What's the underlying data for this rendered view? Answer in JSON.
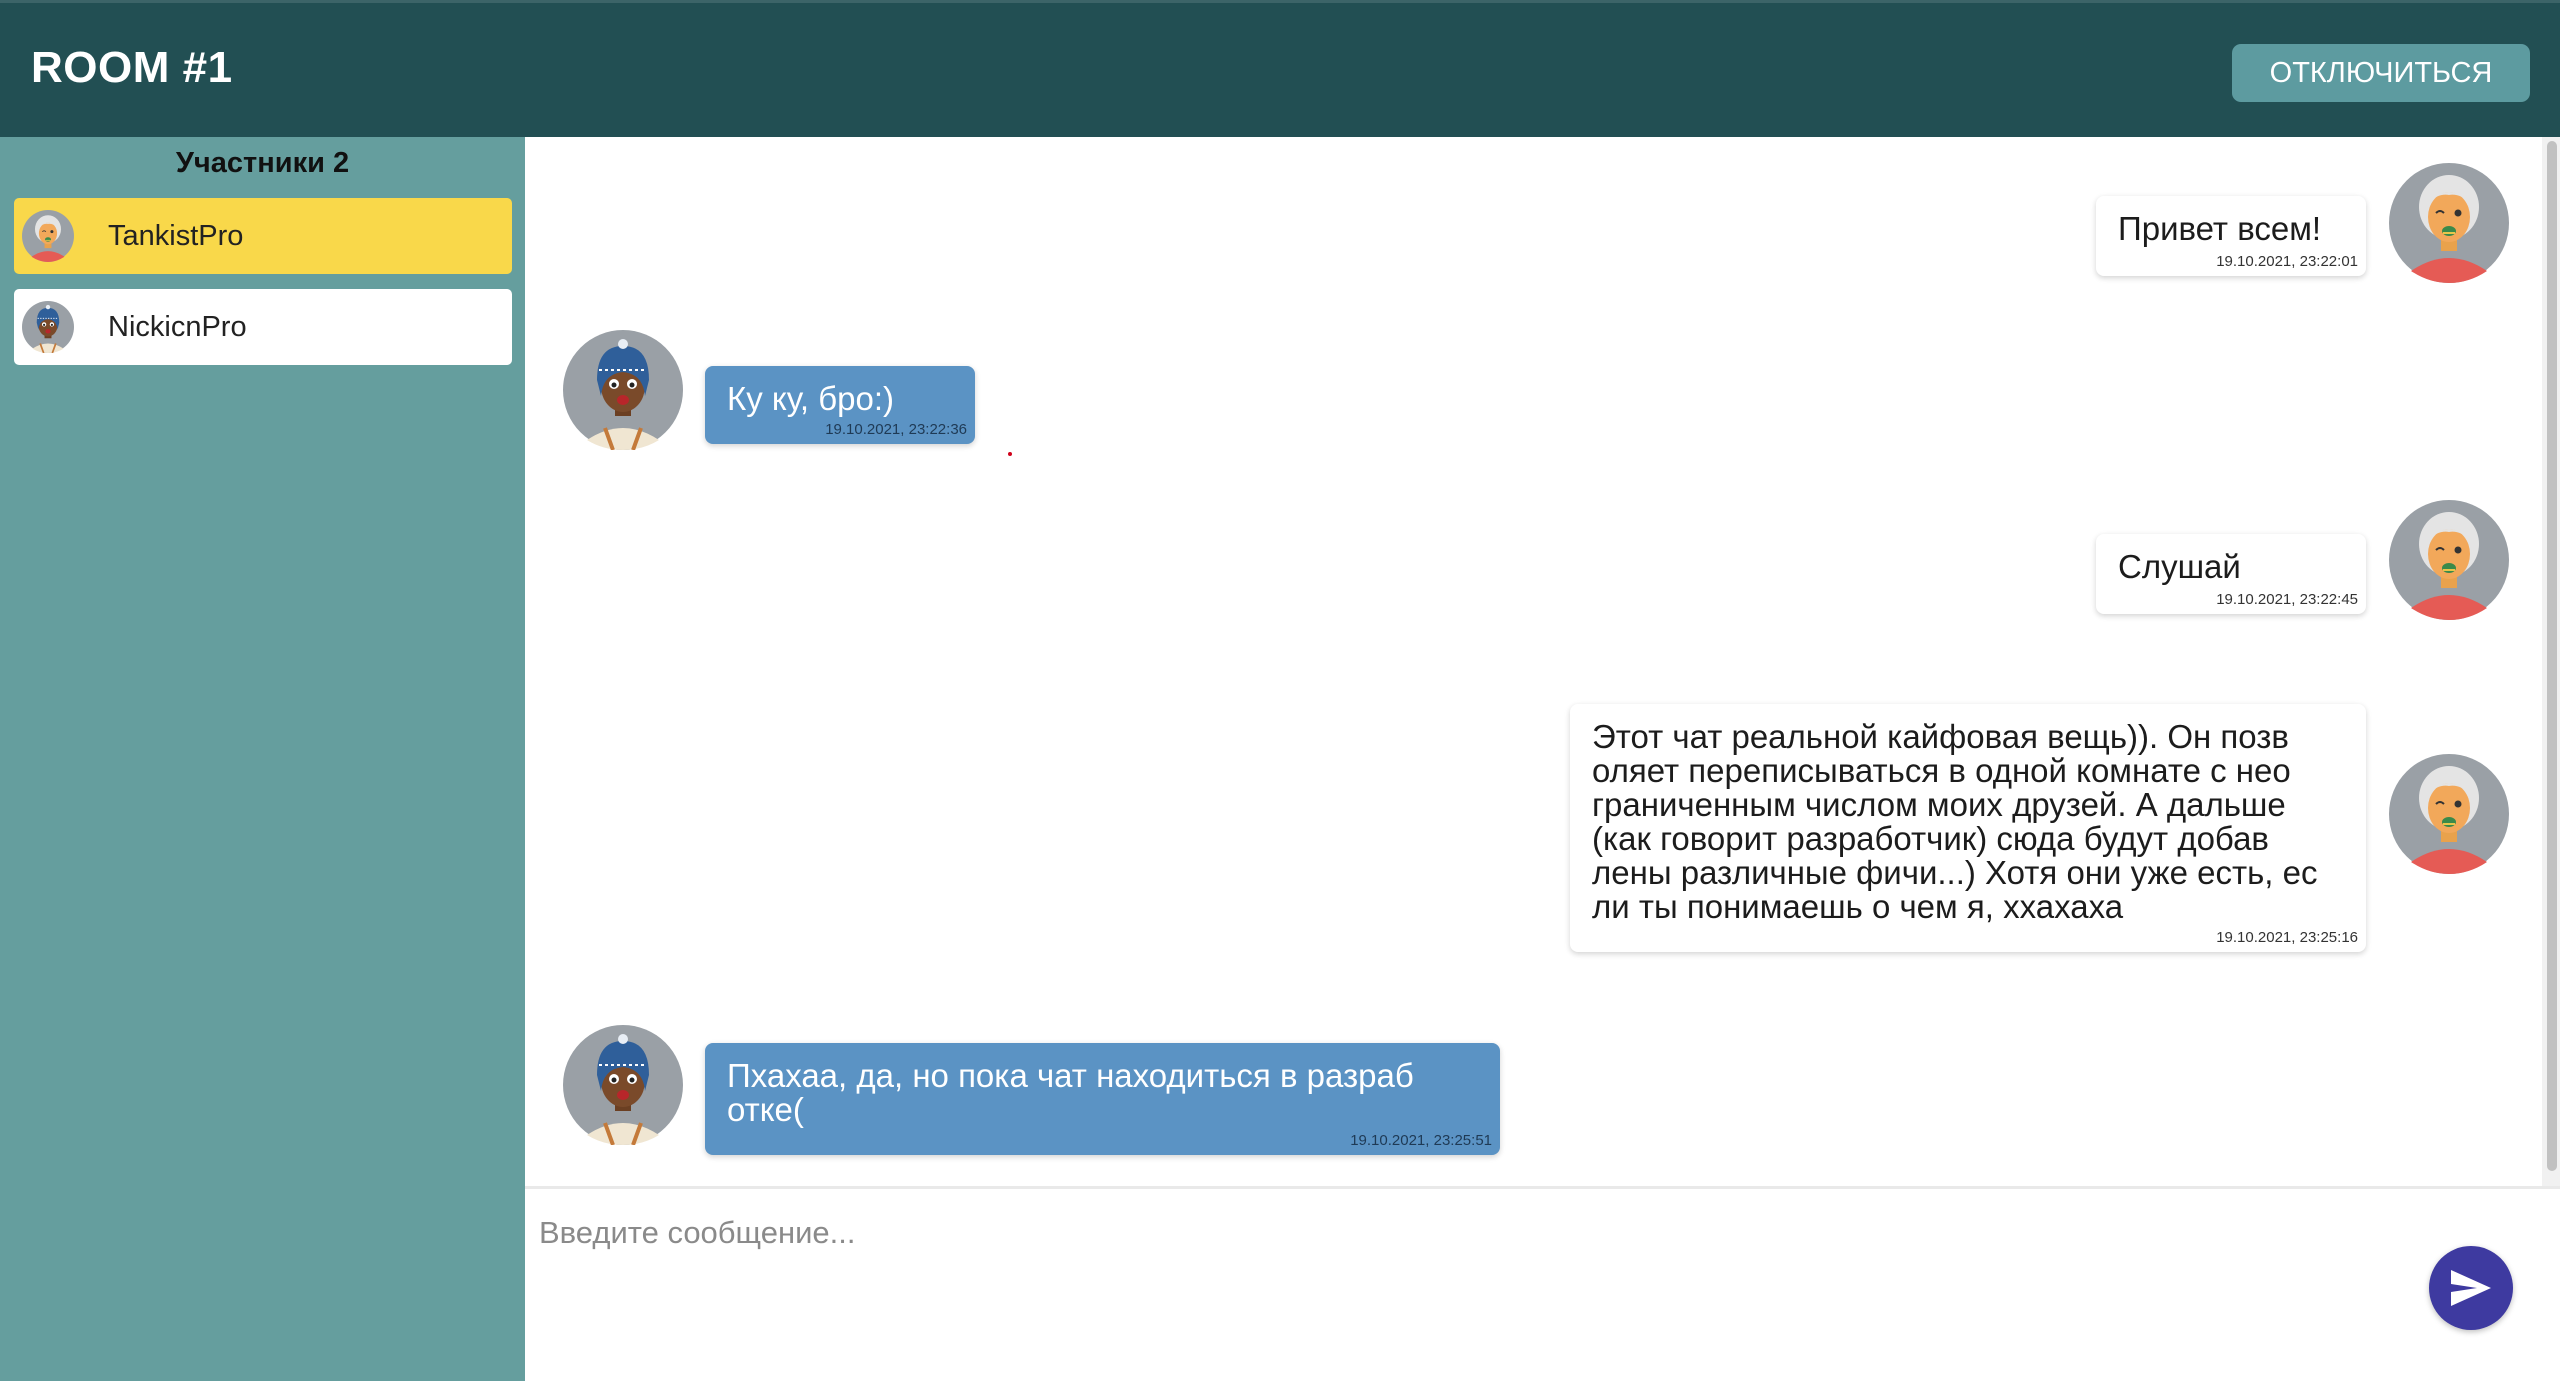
{
  "header": {
    "title": "ROOM #1",
    "disconnect_label": "ОТКЛЮЧИТЬСЯ"
  },
  "sidebar": {
    "title": "Участники 2",
    "participants": [
      {
        "name": "TankistPro",
        "avatar": "grandma-avatar-icon",
        "active": true
      },
      {
        "name": "NickicnPro",
        "avatar": "beanie-man-avatar-icon",
        "active": false
      }
    ]
  },
  "messages": [
    {
      "author": "TankistPro",
      "own": true,
      "text": "Привет всем!",
      "time": "19.10.2021, 23:22:01"
    },
    {
      "author": "NickicnPro",
      "own": false,
      "text": "Ку ку, бро:)",
      "time": "19.10.2021, 23:22:36"
    },
    {
      "author": "TankistPro",
      "own": true,
      "text": "Слушай",
      "time": "19.10.2021, 23:22:45"
    },
    {
      "author": "TankistPro",
      "own": true,
      "text": "Этот чат реальной кайфовая вещь)). Он позв\nоляет переписываться в одной комнате с нео\nграниченным числом моих друзей. А дальше\n(как говорит разработчик) сюда будут добав\nлены различные фичи...) Хотя они уже есть, ес\nли ты понимаешь о чем я, ххахаха",
      "time": "19.10.2021, 23:25:16"
    },
    {
      "author": "NickicnPro",
      "own": false,
      "text": "Пхахаа, да, но пока чат находиться в разраб\nотке(",
      "time": "19.10.2021, 23:25:51"
    }
  ],
  "composer": {
    "placeholder": "Введите сообщение...",
    "send_icon": "send-icon"
  },
  "colors": {
    "header": "#224f53",
    "sidebar": "#659e9e",
    "active_participant": "#f9d84a",
    "own_bubble": "#ffffff",
    "other_bubble": "#5b93c4",
    "disconnect_button": "#5d9ba0",
    "send_button": "#3e3aa0"
  }
}
